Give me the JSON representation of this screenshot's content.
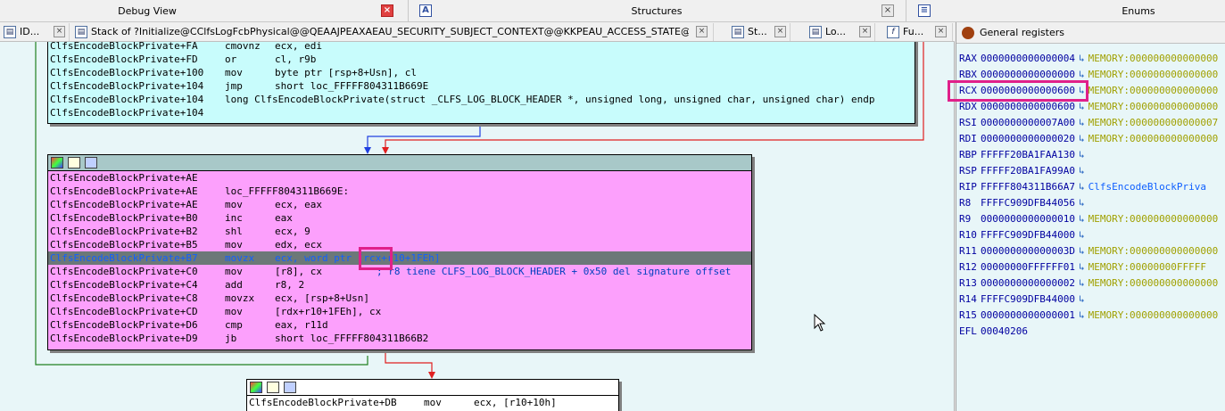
{
  "tabs": {
    "debug_view": "Debug View",
    "structures": "Structures",
    "enums": "Enums"
  },
  "subtabs": [
    {
      "label": "ID...",
      "icon": "IDA"
    },
    {
      "label": "Stack of ?Initialize@CClfsLogFcbPhysical@@QEAAJPEAXAEAU_SECURITY_SUBJECT_CONTEXT@@KKPEAU_ACCESS_STATE@@DPEAU_C...",
      "icon": "S"
    },
    {
      "label": "St...",
      "icon": "St"
    },
    {
      "label": "Lo...",
      "icon": "Lo"
    },
    {
      "label": "Fu...",
      "icon": "f"
    }
  ],
  "block1": {
    "rows": [
      {
        "addr": "ClfsEncodeBlockPrivate+FA",
        "mn": "cmovnz",
        "op": "ecx, edi"
      },
      {
        "addr": "ClfsEncodeBlockPrivate+FD",
        "mn": "or",
        "op": "cl, r9b"
      },
      {
        "addr": "ClfsEncodeBlockPrivate+100",
        "mn": "mov",
        "op": "byte ptr [rsp+8+Usn], cl"
      },
      {
        "addr": "ClfsEncodeBlockPrivate+104",
        "mn": "jmp",
        "op": "short loc_FFFFF804311B669E"
      },
      {
        "addr": "ClfsEncodeBlockPrivate+104",
        "mn": "long ClfsEncodeBlockPrivate(struct _CLFS_LOG_BLOCK_HEADER *, unsigned long, unsigned char, unsigned char) endp",
        "op": ""
      },
      {
        "addr": "ClfsEncodeBlockPrivate+104",
        "mn": "",
        "op": ""
      }
    ]
  },
  "block2": {
    "rows": [
      {
        "addr": "ClfsEncodeBlockPrivate+AE",
        "mn": "",
        "op": ""
      },
      {
        "addr": "ClfsEncodeBlockPrivate+AE",
        "mn": "loc_FFFFF804311B669E:",
        "op": ""
      },
      {
        "addr": "ClfsEncodeBlockPrivate+AE",
        "mn": "mov",
        "op": "ecx, eax"
      },
      {
        "addr": "ClfsEncodeBlockPrivate+B0",
        "mn": "inc",
        "op": "eax"
      },
      {
        "addr": "ClfsEncodeBlockPrivate+B2",
        "mn": "shl",
        "op": "ecx, 9"
      },
      {
        "addr": "ClfsEncodeBlockPrivate+B5",
        "mn": "mov",
        "op": "edx, ecx"
      },
      {
        "addr": "ClfsEncodeBlockPrivate+B7",
        "mn": "movzx",
        "op": "ecx, word ptr [rcx+r10+1FEh]"
      },
      {
        "addr": "ClfsEncodeBlockPrivate+C0",
        "mn": "mov",
        "op": "[r8], cx",
        "cmt": "; r8 tiene CLFS_LOG_BLOCK_HEADER + 0x50 del signature offset"
      },
      {
        "addr": "ClfsEncodeBlockPrivate+C4",
        "mn": "add",
        "op": "r8, 2"
      },
      {
        "addr": "ClfsEncodeBlockPrivate+C8",
        "mn": "movzx",
        "op": "ecx, [rsp+8+Usn]"
      },
      {
        "addr": "ClfsEncodeBlockPrivate+CD",
        "mn": "mov",
        "op": "[rdx+r10+1FEh], cx"
      },
      {
        "addr": "ClfsEncodeBlockPrivate+D6",
        "mn": "cmp",
        "op": "eax, r11d"
      },
      {
        "addr": "ClfsEncodeBlockPrivate+D9",
        "mn": "jb",
        "op": "short loc_FFFFF804311B66B2"
      }
    ]
  },
  "block3": {
    "rows": [
      {
        "addr": "ClfsEncodeBlockPrivate+DB",
        "mn": "mov",
        "op": "ecx, [r10+10h]"
      }
    ]
  },
  "registers": {
    "title": "General registers",
    "rows": [
      {
        "name": "RAX",
        "value": "0000000000000004",
        "ref": "MEMORY:000000000000000"
      },
      {
        "name": "RBX",
        "value": "0000000000000000",
        "ref": "MEMORY:000000000000000"
      },
      {
        "name": "RCX",
        "value": "0000000000000600",
        "ref": "MEMORY:000000000000000"
      },
      {
        "name": "RDX",
        "value": "0000000000000600",
        "ref": "MEMORY:000000000000000"
      },
      {
        "name": "RSI",
        "value": "0000000000007A00",
        "ref": "MEMORY:000000000000007"
      },
      {
        "name": "RDI",
        "value": "0000000000000020",
        "ref": "MEMORY:000000000000000"
      },
      {
        "name": "RBP",
        "value": "FFFFF20BA1FAA130",
        "ref": ""
      },
      {
        "name": "RSP",
        "value": "FFFFF20BA1FA99A0",
        "ref": ""
      },
      {
        "name": "RIP",
        "value": "FFFFF804311B66A7",
        "ref": "ClfsEncodeBlockPriva"
      },
      {
        "name": "R8",
        "value": "FFFFC909DFB44056",
        "ref": ""
      },
      {
        "name": "R9",
        "value": "0000000000000010",
        "ref": "MEMORY:000000000000000"
      },
      {
        "name": "R10",
        "value": "FFFFC909DFB44000",
        "ref": ""
      },
      {
        "name": "R11",
        "value": "000000000000003D",
        "ref": "MEMORY:000000000000000"
      },
      {
        "name": "R12",
        "value": "00000000FFFFFF01",
        "ref": "MEMORY:00000000FFFFF"
      },
      {
        "name": "R13",
        "value": "0000000000000002",
        "ref": "MEMORY:000000000000000"
      },
      {
        "name": "R14",
        "value": "FFFFC909DFB44000",
        "ref": ""
      },
      {
        "name": "R15",
        "value": "0000000000000001",
        "ref": "MEMORY:000000000000000"
      },
      {
        "name": "EFL",
        "value": "00040206",
        "ref": ""
      }
    ]
  },
  "colors": {
    "graph_bg": "#e8f6f8",
    "block_cyan": "#c8fcfc",
    "block_pink": "#fca0fc",
    "highlight": "#e0208a",
    "edge_green": "#208020",
    "edge_red": "#e02020",
    "edge_blue": "#2040e0"
  }
}
